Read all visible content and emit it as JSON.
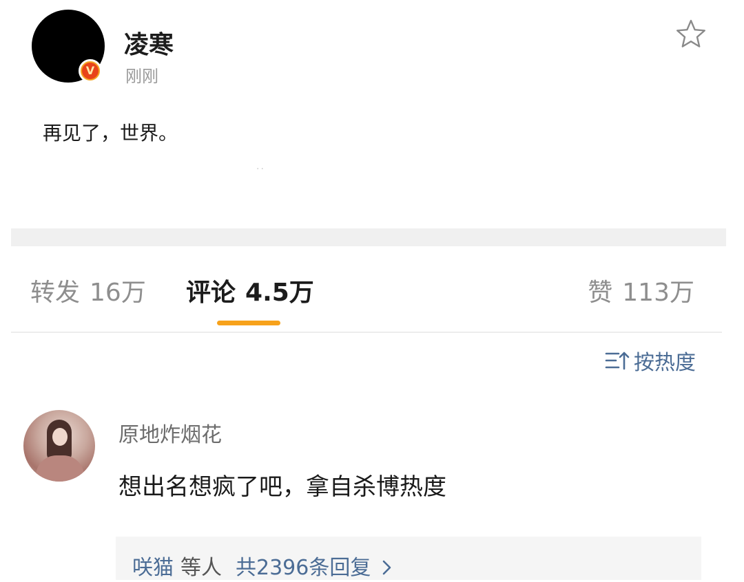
{
  "post": {
    "author": "凌寒",
    "time": "刚刚",
    "text": "再见了，世界。",
    "dots": "··"
  },
  "tabs": {
    "repost": {
      "label": "转发",
      "count": "16万"
    },
    "comment": {
      "label": "评论",
      "count": "4.5万"
    },
    "like": {
      "label": "赞",
      "count": "113万"
    }
  },
  "sort": {
    "label": "按热度"
  },
  "comments": [
    {
      "user": "原地炸烟花",
      "text": "想出名想疯了吧，拿自杀博热度",
      "replies": {
        "first_user": "咲猫",
        "etc": "等人",
        "total": "共2396条回复"
      }
    }
  ],
  "colors": {
    "accent": "#f7a21b",
    "link": "#4b6c95",
    "verified": "#e8441a"
  },
  "icons": [
    "verified-badge-icon",
    "star-icon",
    "sort-icon",
    "chevron-right-icon"
  ]
}
